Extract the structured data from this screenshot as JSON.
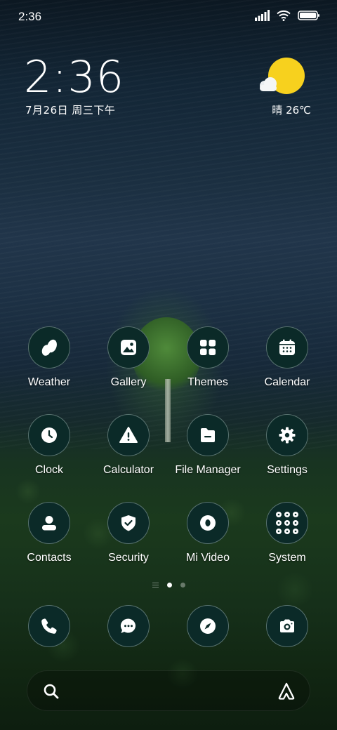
{
  "status_bar": {
    "time": "2:36",
    "icons": [
      "signal-icon",
      "wifi-icon",
      "battery-icon"
    ]
  },
  "clock_widget": {
    "time": "2:36",
    "date": "7月26日 周三下午"
  },
  "weather_widget": {
    "icon": "sun-cloud-icon",
    "text": "晴 26℃",
    "sun_color": "#f7d11e"
  },
  "apps": [
    {
      "label": "Weather",
      "icon": "weather-icon"
    },
    {
      "label": "Gallery",
      "icon": "gallery-icon"
    },
    {
      "label": "Themes",
      "icon": "themes-icon"
    },
    {
      "label": "Calendar",
      "icon": "calendar-icon"
    },
    {
      "label": "Clock",
      "icon": "clock-icon"
    },
    {
      "label": "Calculator",
      "icon": "calculator-icon"
    },
    {
      "label": "File Manager",
      "icon": "file-manager-icon"
    },
    {
      "label": "Settings",
      "icon": "settings-icon"
    },
    {
      "label": "Contacts",
      "icon": "contacts-icon"
    },
    {
      "label": "Security",
      "icon": "security-icon"
    },
    {
      "label": "Mi Video",
      "icon": "mi-video-icon"
    },
    {
      "label": "System",
      "icon": "system-folder-icon"
    }
  ],
  "page_indicator": {
    "pages": 2,
    "current": 1
  },
  "dock": [
    {
      "icon": "phone-icon"
    },
    {
      "icon": "messages-icon"
    },
    {
      "icon": "browser-icon"
    },
    {
      "icon": "camera-icon"
    }
  ],
  "search_bar": {
    "left_icon": "search-icon",
    "right_icon": "assistant-icon"
  },
  "colors": {
    "icon_bg": "#0b2a28",
    "icon_fg": "#ffffff",
    "accent_sun": "#f7d11e"
  }
}
